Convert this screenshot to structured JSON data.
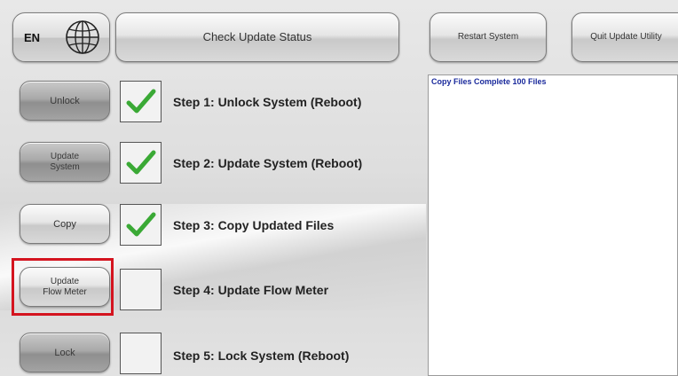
{
  "header": {
    "language_code": "EN",
    "check_update_status_label": "Check Update Status",
    "restart_system_label": "Restart System",
    "quit_update_utility_label": "Quit Update Utility"
  },
  "steps": [
    {
      "button_label_line1": "Unlock",
      "button_label_line2": "",
      "step_text": "Step 1: Unlock System (Reboot)",
      "checked": true,
      "button_style": "dark"
    },
    {
      "button_label_line1": "Update",
      "button_label_line2": "System",
      "step_text": "Step 2: Update System (Reboot)",
      "checked": true,
      "button_style": "dark"
    },
    {
      "button_label_line1": "Copy",
      "button_label_line2": "",
      "step_text": "Step 3: Copy Updated Files",
      "checked": true,
      "button_style": "light"
    },
    {
      "button_label_line1": "Update",
      "button_label_line2": "Flow Meter",
      "step_text": "Step 4: Update Flow Meter",
      "checked": false,
      "button_style": "light"
    },
    {
      "button_label_line1": "Lock",
      "button_label_line2": "",
      "step_text": "Step 5: Lock System (Reboot)",
      "checked": false,
      "button_style": "dark"
    }
  ],
  "log": {
    "text": "Copy Files Complete 100 Files"
  },
  "colors": {
    "check_green": "#3aa935",
    "highlight_red": "#d4141f",
    "log_text_blue": "#1a2a9c"
  },
  "icons": {
    "language": "globe-icon",
    "check": "checkmark-icon"
  }
}
